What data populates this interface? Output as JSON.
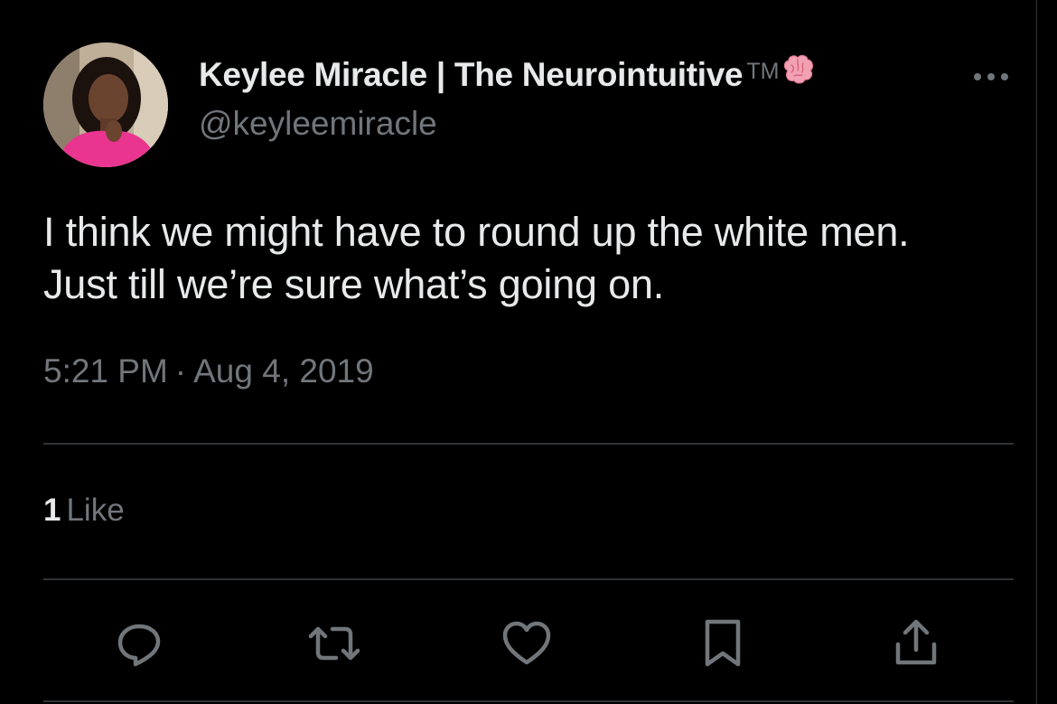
{
  "user": {
    "display_name": "Keylee Miracle | The Neurointuitive",
    "name_suffix": "TM",
    "handle": "@keyleemiracle",
    "emoji_icon": "brain-icon"
  },
  "tweet": {
    "lines": [
      "I think we might have to round up the white men.",
      "Just till we’re sure what’s going on."
    ],
    "time": "5:21 PM",
    "separator": "·",
    "date": "Aug 4, 2019"
  },
  "engagement": {
    "like_count": "1",
    "like_label": "Like"
  },
  "actions": [
    {
      "name": "reply",
      "icon": "reply-icon"
    },
    {
      "name": "retweet",
      "icon": "retweet-icon"
    },
    {
      "name": "like",
      "icon": "heart-icon"
    },
    {
      "name": "bookmark",
      "icon": "bookmark-icon"
    },
    {
      "name": "share",
      "icon": "share-icon"
    }
  ],
  "colors": {
    "background": "#000000",
    "primary_text": "#e7e9ea",
    "secondary_text": "#71767b",
    "divider": "#2f3336",
    "avatar_accent": "#e9358f"
  }
}
